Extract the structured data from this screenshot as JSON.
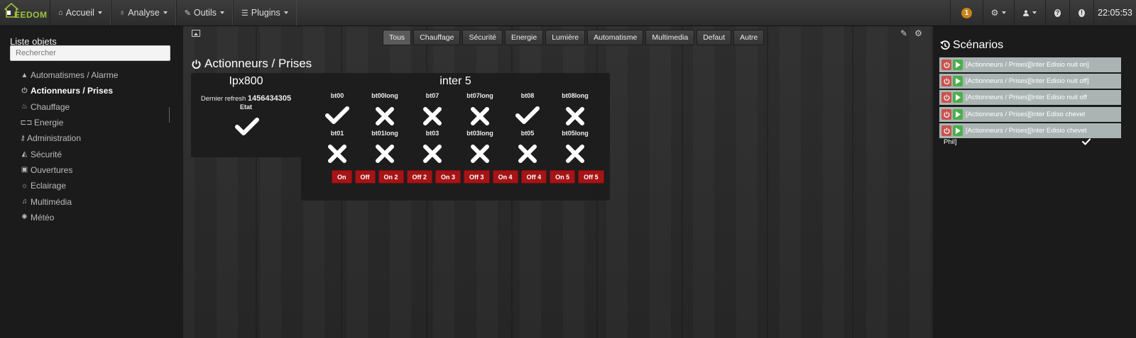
{
  "navbar": {
    "logo_text": "EEDOM",
    "items": [
      {
        "label": "Accueil",
        "icon": "home-icon"
      },
      {
        "label": "Analyse",
        "icon": "stethoscope-icon"
      },
      {
        "label": "Outils",
        "icon": "wrench-icon"
      },
      {
        "label": "Plugins",
        "icon": "tasks-icon"
      }
    ],
    "notification_count": "1",
    "clock": "22:05:53"
  },
  "sidebar": {
    "title": "Liste objets",
    "search_placeholder": "Rechercher",
    "items": [
      {
        "label": "Automatismes / Alarme",
        "icon": "graduation-cap-icon",
        "active": false
      },
      {
        "label": "Actionneurs / Prises",
        "icon": "power-icon",
        "active": true
      },
      {
        "label": "Chauffage",
        "icon": "fire-icon",
        "active": false
      },
      {
        "label": "Energie",
        "icon": "plug-icon",
        "active": false
      },
      {
        "label": "Administration",
        "icon": "key-icon",
        "active": false
      },
      {
        "label": "Sécurité",
        "icon": "siren-icon",
        "active": false
      },
      {
        "label": "Ouvertures",
        "icon": "window-icon",
        "active": false
      },
      {
        "label": "Eclairage",
        "icon": "lightbulb-icon",
        "active": false
      },
      {
        "label": "Multimédia",
        "icon": "music-icon",
        "active": false
      },
      {
        "label": "Météo",
        "icon": "sun-icon",
        "active": false
      }
    ]
  },
  "filters": [
    "Tous",
    "Chauffage",
    "Sécurité",
    "Energie",
    "Lumière",
    "Automatisme",
    "Multimedia",
    "Defaut",
    "Autre"
  ],
  "active_filter": "Tous",
  "page_title": "Actionneurs / Prises",
  "widget_ipx": {
    "title": "Ipx800",
    "refresh_label": "Dernier refresh",
    "refresh_value": "1456434305",
    "etat_label": "Etat",
    "etat": "on"
  },
  "widget_inter": {
    "title": "inter 5",
    "rows": [
      [
        {
          "label": "bt00",
          "state": "on"
        },
        {
          "label": "bt00long",
          "state": "off"
        },
        {
          "label": "bt07",
          "state": "off"
        },
        {
          "label": "bt07long",
          "state": "off"
        },
        {
          "label": "bt08",
          "state": "on"
        },
        {
          "label": "bt08long",
          "state": "off"
        }
      ],
      [
        {
          "label": "bt01",
          "state": "off"
        },
        {
          "label": "bt01long",
          "state": "off"
        },
        {
          "label": "bt03",
          "state": "off"
        },
        {
          "label": "bt03long",
          "state": "off"
        },
        {
          "label": "bt05",
          "state": "off"
        },
        {
          "label": "bt05long",
          "state": "off"
        }
      ]
    ],
    "buttons": [
      "On",
      "Off",
      "On 2",
      "Off 2",
      "On 3",
      "Off 3",
      "On 4",
      "Off 4",
      "On 5",
      "Off 5"
    ]
  },
  "scenarios": {
    "title": "Scénarios",
    "items": [
      "[Actionneurs / Prises][Inter Edisio nuit on]",
      "[Actionneurs / Prises][Inter Edisio nuit off]",
      "[Actionneurs / Prises][Inter Edisio nuit off",
      "[Actionneurs / Prises][Inter Ediso chevet",
      "[Actionneurs / Prises][Inter Edisio chevet"
    ],
    "last_line": "Phil]"
  },
  "colors": {
    "accent_green": "#9ec33a",
    "button_red": "#a51416",
    "badge_orange": "#c8841a",
    "scenario_bg": "#aab5b3",
    "stop_red": "#c9534f",
    "play_green": "#4cae4c"
  }
}
